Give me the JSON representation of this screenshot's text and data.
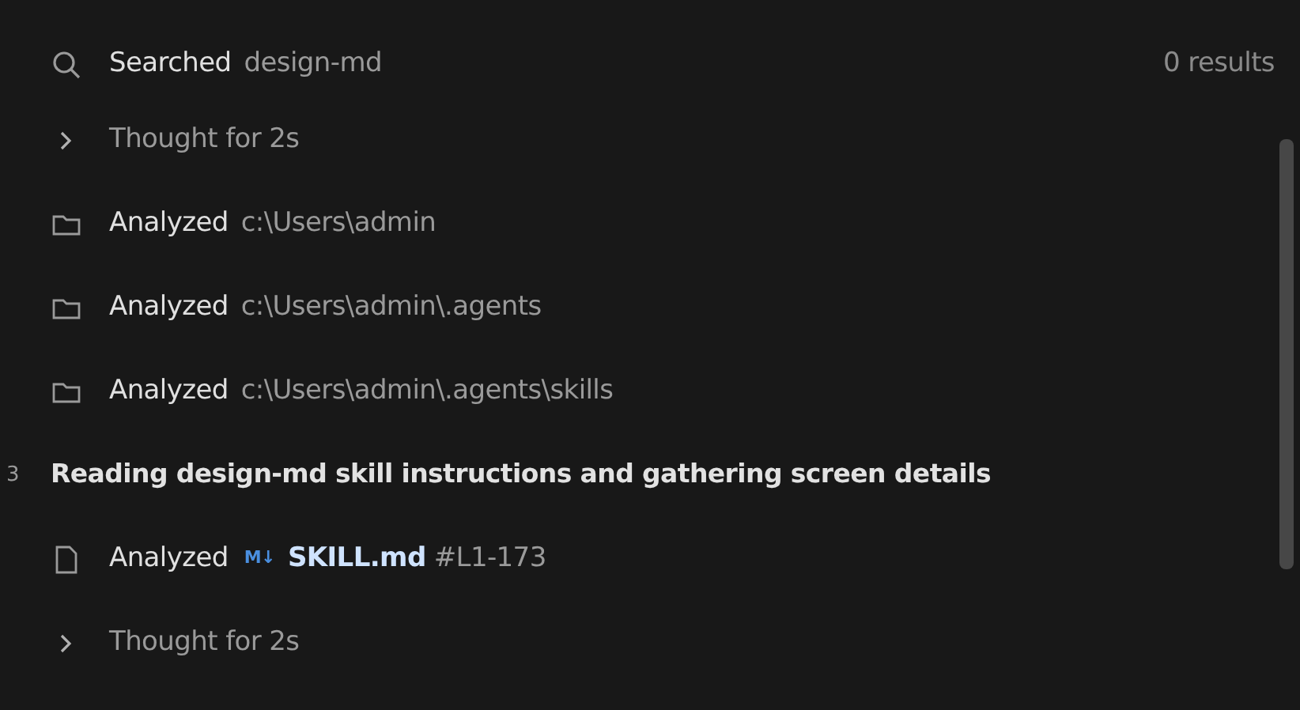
{
  "steps": [
    {
      "kind": "search",
      "action": "Searched",
      "target": "design-md",
      "count": "0 results"
    },
    {
      "kind": "thought",
      "label": "Thought for 2s"
    },
    {
      "kind": "folder",
      "action": "Analyzed",
      "target": "c:\\Users\\admin"
    },
    {
      "kind": "folder",
      "action": "Analyzed",
      "target": "c:\\Users\\admin\\.agents"
    },
    {
      "kind": "folder",
      "action": "Analyzed",
      "target": "c:\\Users\\admin\\.agents\\skills"
    },
    {
      "kind": "heading",
      "number": "3",
      "label": "Reading design-md skill instructions and gathering screen details"
    },
    {
      "kind": "file",
      "action": "Analyzed",
      "badge": "M↓",
      "file": "SKILL.md",
      "range": "#L1-173"
    },
    {
      "kind": "thought",
      "label": "Thought for 2s"
    }
  ]
}
